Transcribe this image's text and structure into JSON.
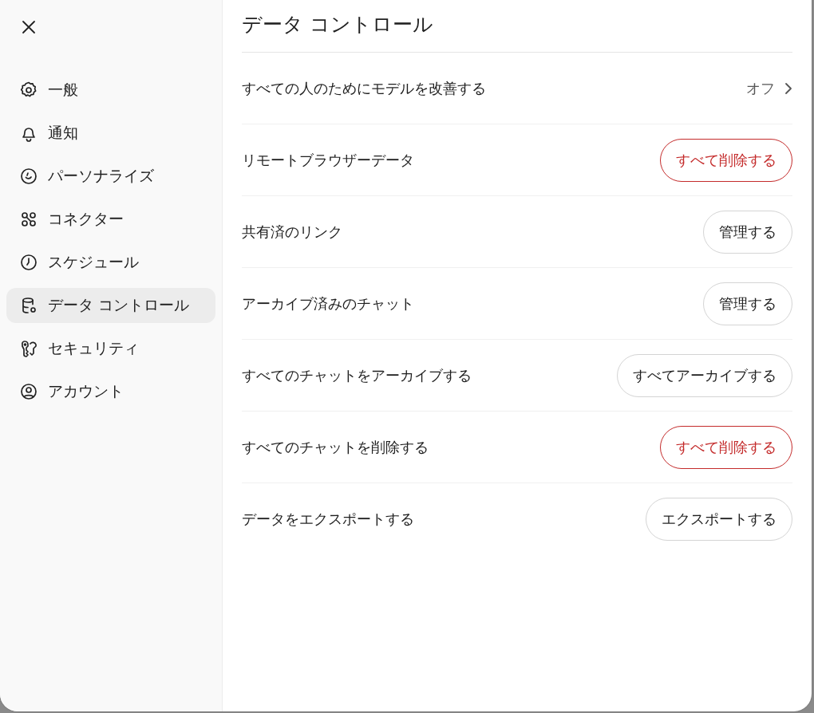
{
  "sidebar": {
    "items": [
      {
        "label": "一般",
        "selected": false
      },
      {
        "label": "通知",
        "selected": false
      },
      {
        "label": "パーソナライズ",
        "selected": false
      },
      {
        "label": "コネクター",
        "selected": false
      },
      {
        "label": "スケジュール",
        "selected": false
      },
      {
        "label": "データ コントロール",
        "selected": true
      },
      {
        "label": "セキュリティ",
        "selected": false
      },
      {
        "label": "アカウント",
        "selected": false
      }
    ]
  },
  "title": "データ コントロール",
  "rows": [
    {
      "label": "すべての人のためにモデルを改善する",
      "kind": "link",
      "value": "オフ"
    },
    {
      "label": "リモートブラウザーデータ",
      "kind": "button",
      "value": "すべて削除する",
      "danger": true
    },
    {
      "label": "共有済のリンク",
      "kind": "button",
      "value": "管理する",
      "danger": false
    },
    {
      "label": "アーカイブ済みのチャット",
      "kind": "button",
      "value": "管理する",
      "danger": false
    },
    {
      "label": "すべてのチャットをアーカイブする",
      "kind": "button",
      "value": "すべてアーカイブする",
      "danger": false
    },
    {
      "label": "すべてのチャットを削除する",
      "kind": "button",
      "value": "すべて削除する",
      "danger": true
    },
    {
      "label": "データをエクスポートする",
      "kind": "button",
      "value": "エクスポートする",
      "danger": false
    }
  ]
}
